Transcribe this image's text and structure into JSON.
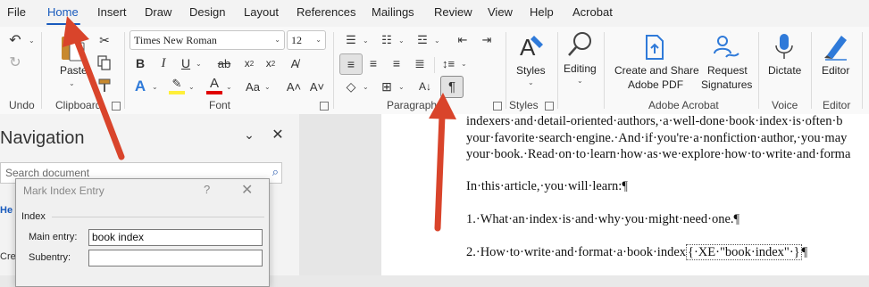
{
  "menubar": {
    "tabs": [
      {
        "label": "File",
        "active": false
      },
      {
        "label": "Home",
        "active": true
      },
      {
        "label": "Insert",
        "active": false
      },
      {
        "label": "Draw",
        "active": false
      },
      {
        "label": "Design",
        "active": false
      },
      {
        "label": "Layout",
        "active": false
      },
      {
        "label": "References",
        "active": false
      },
      {
        "label": "Mailings",
        "active": false
      },
      {
        "label": "Review",
        "active": false
      },
      {
        "label": "View",
        "active": false
      },
      {
        "label": "Help",
        "active": false
      },
      {
        "label": "Acrobat",
        "active": false
      }
    ]
  },
  "ribbon": {
    "groups": {
      "undo": "Undo",
      "clipboard": "Clipboard",
      "font": "Font",
      "paragraph": "Paragraph",
      "styles": "Styles",
      "adobe": "Adobe Acrobat",
      "voice": "Voice",
      "editor": "Editor"
    },
    "paste_label": "Paste",
    "font_name": "Times New Roman",
    "font_size": "12",
    "styles_label": "Styles",
    "editing_label": "Editing",
    "create_share_line1": "Create and Share",
    "create_share_line2": "Adobe PDF",
    "request_line1": "Request",
    "request_line2": "Signatures",
    "dictate_label": "Dictate",
    "editor_label": "Editor",
    "icon_text": {
      "bold": "B",
      "italic": "I",
      "underline": "U",
      "strike": "ab",
      "subscript": "x",
      "subscript_sub": "2",
      "superscript": "x",
      "superscript_sup": "2",
      "case": "Aa",
      "text_effects": "A",
      "font_color": "A",
      "pilcrow": "¶",
      "sort": "A"
    },
    "highlight_color": "#ffef3a",
    "font_color_bar": "#e00000"
  },
  "navigation": {
    "title": "Navigation",
    "search_placeholder": "Search document",
    "peek_tab": "He",
    "peek_text": "Cre"
  },
  "dialog": {
    "title": "Mark Index Entry",
    "help": "?",
    "close": "✕",
    "section": "Index",
    "main_entry_label": "Main entry:",
    "main_entry_value": "book index",
    "subentry_label": "Subentry:",
    "subentry_value": ""
  },
  "document": {
    "line1": "indexers·and·detail-oriented·authors,·a·well-done·book·index·is·often·b",
    "line2": "your·favorite·search·engine.·And·if·you're·a·nonfiction·author,·you·may",
    "line3": "your·book.·Read·on·to·learn·how·as·we·explore·how·to·write·and·forma",
    "line4": "In·this·article,·you·will·learn:¶",
    "line5": "1.·What·an·index·is·and·why·you·might·need·one.¶",
    "line6_pre": "2.·How·to·write·and·format·a·book·index",
    "line6_field": "{·XE·\"book·index\"·}",
    "line6_post": "¶"
  },
  "colors": {
    "accent": "#185abd",
    "arrow": "#d9442b"
  }
}
